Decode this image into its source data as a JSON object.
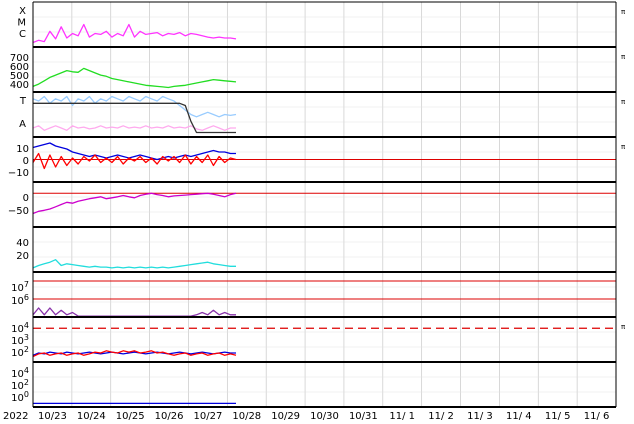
{
  "chart_data": {
    "type": "line",
    "year_label": "2022",
    "x_ticks": [
      "10/23",
      "10/24",
      "10/25",
      "10/26",
      "10/27",
      "10/28",
      "10/29",
      "10/30",
      "10/31",
      "11/ 1",
      "11/ 2",
      "11/ 3",
      "11/ 4",
      "11/ 5",
      "11/ 6"
    ],
    "grid": true,
    "right_marker": "π",
    "panels": [
      {
        "id": "xmc",
        "left_labels": [
          "X",
          "M",
          "C"
        ],
        "tick_labels": [],
        "series": [
          {
            "color": "#ff33ff",
            "y": [
              0.1,
              0.15,
              0.12,
              0.35,
              0.18,
              0.45,
              0.2,
              0.3,
              0.25,
              0.5,
              0.22,
              0.3,
              0.28,
              0.35,
              0.22,
              0.3,
              0.25,
              0.5,
              0.22,
              0.35,
              0.28,
              0.3,
              0.32,
              0.25,
              0.3,
              0.28,
              0.32,
              0.25,
              0.3,
              0.28,
              0.25,
              0.22,
              0.2,
              0.22,
              0.2,
              0.2,
              0.18
            ]
          }
        ]
      },
      {
        "id": "sw-speed",
        "left_labels": [],
        "tick_labels": [
          "700",
          "600",
          "500",
          "400"
        ],
        "ylim": [
          350,
          750
        ],
        "series": [
          {
            "color": "#22dd22",
            "y": [
              400,
              420,
              450,
              480,
              500,
              520,
              540,
              530,
              525,
              560,
              540,
              520,
              500,
              490,
              470,
              460,
              450,
              440,
              430,
              420,
              410,
              405,
              400,
              395,
              390,
              400,
              405,
              410,
              420,
              430,
              440,
              450,
              460,
              455,
              450,
              445,
              440
            ]
          }
        ]
      },
      {
        "id": "imf-sector",
        "left_labels": [
          "T",
          "A"
        ],
        "tick_labels": [],
        "series": [
          {
            "color": "#99ccff",
            "y": [
              0.85,
              0.8,
              0.9,
              0.75,
              0.85,
              0.8,
              0.9,
              0.7,
              0.85,
              0.8,
              0.9,
              0.75,
              0.85,
              0.8,
              0.9,
              0.85,
              0.8,
              0.9,
              0.85,
              0.8,
              0.9,
              0.85,
              0.8,
              0.9,
              0.85,
              0.8,
              0.7,
              0.6,
              0.5,
              0.45,
              0.5,
              0.55,
              0.5,
              0.45,
              0.5,
              0.48,
              0.5
            ]
          },
          {
            "color": "#ffaaee",
            "y": [
              0.2,
              0.25,
              0.15,
              0.2,
              0.25,
              0.2,
              0.15,
              0.25,
              0.2,
              0.22,
              0.18,
              0.2,
              0.25,
              0.2,
              0.22,
              0.2,
              0.25,
              0.2,
              0.22,
              0.2,
              0.25,
              0.2,
              0.22,
              0.2,
              0.25,
              0.2,
              0.22,
              0.2,
              0.25,
              0.18,
              0.15,
              0.2,
              0.25,
              0.2,
              0.15,
              0.2,
              0.2
            ]
          },
          {
            "color": "#333333",
            "y": [
              0.75,
              0.75,
              0.75,
              0.75,
              0.75,
              0.75,
              0.75,
              0.75,
              0.75,
              0.75,
              0.75,
              0.75,
              0.75,
              0.75,
              0.75,
              0.75,
              0.75,
              0.75,
              0.75,
              0.75,
              0.75,
              0.75,
              0.75,
              0.75,
              0.75,
              0.75,
              0.75,
              0.7,
              0.35,
              0.1,
              0.1,
              0.1,
              0.1,
              0.1,
              0.1,
              0.1,
              0.1
            ]
          }
        ]
      },
      {
        "id": "imf-bz",
        "left_labels": [],
        "tick_labels": [
          "10",
          "0",
          "−10"
        ],
        "ylim": [
          -15,
          15
        ],
        "zero_line": 0,
        "series": [
          {
            "color": "#0000dd",
            "y": [
              8,
              9,
              10,
              11,
              9,
              8,
              7,
              5,
              4,
              3,
              2,
              3,
              2,
              1,
              2,
              3,
              2,
              1,
              2,
              3,
              2,
              1,
              0,
              1,
              2,
              1,
              2,
              3,
              2,
              3,
              4,
              5,
              6,
              5,
              5,
              4,
              4
            ]
          },
          {
            "color": "#ff0000",
            "y": [
              -2,
              4,
              -6,
              3,
              -5,
              2,
              -4,
              1,
              -3,
              2,
              -1,
              3,
              -2,
              1,
              -2,
              2,
              -3,
              1,
              -1,
              2,
              -2,
              1,
              -3,
              2,
              -1,
              2,
              -2,
              3,
              -3,
              2,
              -2,
              3,
              -4,
              2,
              -2,
              1,
              0
            ]
          }
        ]
      },
      {
        "id": "dst",
        "left_labels": [],
        "tick_labels": [
          "0",
          "−50"
        ],
        "ylim": [
          -75,
          25
        ],
        "zero_line": 0,
        "series": [
          {
            "color": "#cc00cc",
            "y": [
              -45,
              -40,
              -38,
              -35,
              -30,
              -25,
              -20,
              -22,
              -18,
              -15,
              -12,
              -10,
              -8,
              -12,
              -10,
              -8,
              -5,
              -8,
              -10,
              -5,
              -2,
              0,
              -3,
              -5,
              -8,
              -6,
              -5,
              -4,
              -3,
              -2,
              -1,
              0,
              -2,
              -5,
              -8,
              -3,
              0
            ]
          }
        ]
      },
      {
        "id": "density",
        "left_labels": [],
        "tick_labels": [
          "40",
          "20"
        ],
        "ylim": [
          0,
          55
        ],
        "series": [
          {
            "color": "#22dddd",
            "y": [
              5,
              8,
              10,
              12,
              15,
              8,
              10,
              9,
              8,
              7,
              6,
              7,
              6,
              6,
              5,
              6,
              5,
              6,
              5,
              6,
              5,
              6,
              5,
              6,
              5,
              6,
              7,
              8,
              9,
              10,
              11,
              12,
              10,
              9,
              8,
              7,
              7
            ]
          }
        ]
      },
      {
        "id": "electron",
        "left_labels": [],
        "tick_labels": [
          "10^7",
          "10^6"
        ],
        "thresholds": [
          0.8,
          0.4
        ],
        "series": [
          {
            "color": "#8833aa",
            "y": [
              0.05,
              0.2,
              0.05,
              0.2,
              0.05,
              0.15,
              0.05,
              0.1,
              0.02,
              0.02,
              0.02,
              0.02,
              0.02,
              0.02,
              0.02,
              0.02,
              0.02,
              0.02,
              0.02,
              0.02,
              0.02,
              0.02,
              0.02,
              0.02,
              0.02,
              0.02,
              0.02,
              0.02,
              0.02,
              0.05,
              0.1,
              0.05,
              0.15,
              0.05,
              0.1,
              0.05,
              0.05
            ]
          }
        ]
      },
      {
        "id": "proton",
        "left_labels": [],
        "tick_labels": [
          "10^4",
          "10^3",
          "10^2"
        ],
        "dashed_line": 0.75,
        "series": [
          {
            "color": "#0000dd",
            "y": [
              0.15,
              0.2,
              0.18,
              0.22,
              0.2,
              0.18,
              0.22,
              0.2,
              0.18,
              0.2,
              0.22,
              0.2,
              0.18,
              0.2,
              0.22,
              0.2,
              0.18,
              0.2,
              0.22,
              0.2,
              0.18,
              0.2,
              0.22,
              0.2,
              0.18,
              0.2,
              0.22,
              0.2,
              0.18,
              0.2,
              0.22,
              0.2,
              0.18,
              0.2,
              0.22,
              0.2,
              0.2
            ]
          },
          {
            "color": "#ff0000",
            "y": [
              0.12,
              0.18,
              0.2,
              0.15,
              0.18,
              0.2,
              0.15,
              0.18,
              0.2,
              0.15,
              0.18,
              0.22,
              0.2,
              0.25,
              0.22,
              0.2,
              0.25,
              0.22,
              0.25,
              0.2,
              0.22,
              0.25,
              0.2,
              0.22,
              0.18,
              0.15,
              0.18,
              0.2,
              0.15,
              0.18,
              0.2,
              0.15,
              0.18,
              0.2,
              0.15,
              0.18,
              0.15
            ]
          }
        ]
      },
      {
        "id": "neutron",
        "left_labels": [],
        "tick_labels": [
          "10^4",
          "10^2",
          "10^0"
        ],
        "series": [
          {
            "color": "#0000dd",
            "y": [
              0.08,
              0.08,
              0.08,
              0.08,
              0.08,
              0.08,
              0.08,
              0.08,
              0.08,
              0.08,
              0.08,
              0.08,
              0.08,
              0.08,
              0.08,
              0.08,
              0.08,
              0.08,
              0.08,
              0.08,
              0.08,
              0.08,
              0.08,
              0.08,
              0.08,
              0.08,
              0.08,
              0.08,
              0.08,
              0.08,
              0.08,
              0.08,
              0.08,
              0.08,
              0.08,
              0.08,
              0.08
            ]
          }
        ]
      }
    ]
  }
}
